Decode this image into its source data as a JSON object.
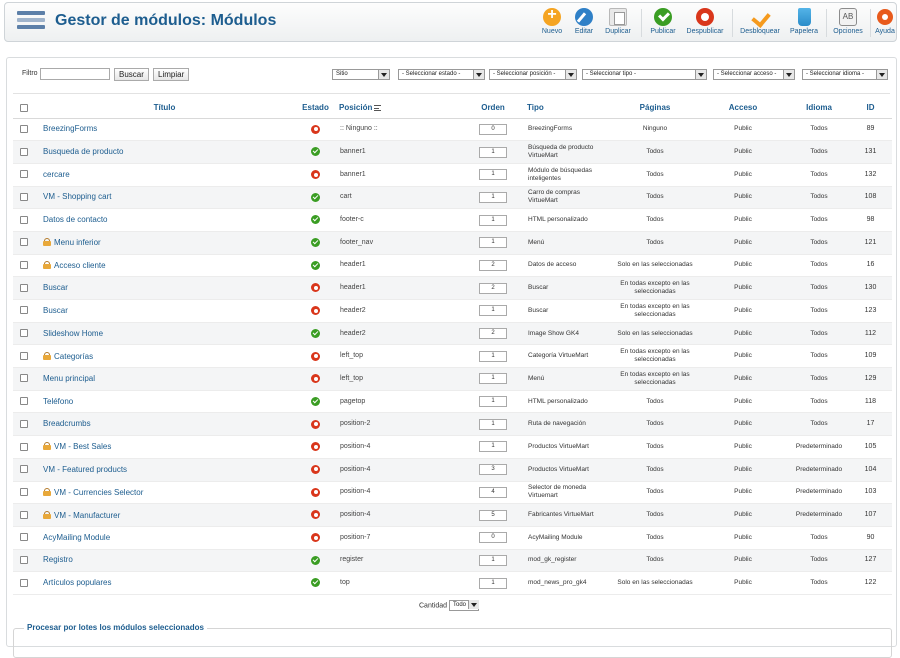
{
  "header": {
    "title": "Gestor de módulos: Módulos",
    "buttons": [
      {
        "id": "new",
        "label": "Nuevo",
        "icon": "plus-circle-icon"
      },
      {
        "id": "edit",
        "label": "Editar",
        "icon": "pencil-icon"
      },
      {
        "id": "copy",
        "label": "Duplicar",
        "icon": "copy-icon"
      },
      {
        "id": "publish",
        "label": "Publicar",
        "icon": "check-circle-icon"
      },
      {
        "id": "unpublish",
        "label": "Despublicar",
        "icon": "stop-circle-icon"
      },
      {
        "id": "unlock",
        "label": "Desbloquear",
        "icon": "checkin-icon"
      },
      {
        "id": "trash",
        "label": "Papelera",
        "icon": "trash-icon"
      },
      {
        "id": "options",
        "label": "Opciones",
        "icon": "options-icon"
      },
      {
        "id": "help",
        "label": "Ayuda",
        "icon": "help-lifebuoy-icon"
      }
    ]
  },
  "filters": {
    "search_label": "Filtro",
    "search_value": "",
    "search_button": "Buscar",
    "clear_button": "Limpiar",
    "client": "Sitio",
    "state": "- Seleccionar estado -",
    "position": "- Seleccionar posición -",
    "type": "- Seleccionar tipo -",
    "access": "- Seleccionar acceso -",
    "language": "- Seleccionar idioma -"
  },
  "table": {
    "columns": {
      "title": "Título",
      "state": "Estado",
      "position": "Posición",
      "order": "Orden",
      "type": "Tipo",
      "pages": "Páginas",
      "access": "Acceso",
      "language": "Idioma",
      "id": "ID"
    },
    "rows": [
      {
        "title": "BreezingForms",
        "locked": false,
        "published": false,
        "position": ":: Ninguno ::",
        "order": "0",
        "type": "BreezingForms",
        "pages": "Ninguno",
        "access": "Public",
        "language": "Todos",
        "id": "89"
      },
      {
        "title": "Busqueda de producto",
        "locked": false,
        "published": true,
        "position": "banner1",
        "order": "1",
        "type": "Búsqueda de producto VirtueMart",
        "pages": "Todos",
        "access": "Public",
        "language": "Todos",
        "id": "131"
      },
      {
        "title": "cercare",
        "locked": false,
        "published": false,
        "position": "banner1",
        "order": "1",
        "type": "Módulo de búsquedas inteligentes",
        "pages": "Todos",
        "access": "Public",
        "language": "Todos",
        "id": "132"
      },
      {
        "title": "VM - Shopping cart",
        "locked": false,
        "published": true,
        "position": "cart",
        "order": "1",
        "type": "Carro de compras VirtueMart",
        "pages": "Todos",
        "access": "Public",
        "language": "Todos",
        "id": "108"
      },
      {
        "title": "Datos de contacto",
        "locked": false,
        "published": true,
        "position": "footer-c",
        "order": "1",
        "type": "HTML personalizado",
        "pages": "Todos",
        "access": "Public",
        "language": "Todos",
        "id": "98"
      },
      {
        "title": "Menu inferior",
        "locked": true,
        "published": true,
        "position": "footer_nav",
        "order": "1",
        "type": "Menú",
        "pages": "Todos",
        "access": "Public",
        "language": "Todos",
        "id": "121"
      },
      {
        "title": "Acceso cliente",
        "locked": true,
        "published": true,
        "position": "header1",
        "order": "2",
        "type": "Datos de acceso",
        "pages": "Solo en las seleccionadas",
        "access": "Public",
        "language": "Todos",
        "id": "16"
      },
      {
        "title": "Buscar",
        "locked": false,
        "published": false,
        "position": "header1",
        "order": "2",
        "type": "Buscar",
        "pages": "En todas excepto en las seleccionadas",
        "access": "Public",
        "language": "Todos",
        "id": "130"
      },
      {
        "title": "Buscar",
        "locked": false,
        "published": false,
        "position": "header2",
        "order": "1",
        "type": "Buscar",
        "pages": "En todas excepto en las seleccionadas",
        "access": "Public",
        "language": "Todos",
        "id": "123"
      },
      {
        "title": "Slideshow Home",
        "locked": false,
        "published": true,
        "position": "header2",
        "order": "2",
        "type": "Image Show GK4",
        "pages": "Solo en las seleccionadas",
        "access": "Public",
        "language": "Todos",
        "id": "112"
      },
      {
        "title": "Categorías",
        "locked": true,
        "published": false,
        "position": "left_top",
        "order": "1",
        "type": "Categoría VirtueMart",
        "pages": "En todas excepto en las seleccionadas",
        "access": "Public",
        "language": "Todos",
        "id": "109"
      },
      {
        "title": "Menu principal",
        "locked": false,
        "published": false,
        "position": "left_top",
        "order": "1",
        "type": "Menú",
        "pages": "En todas excepto en las seleccionadas",
        "access": "Public",
        "language": "Todos",
        "id": "129"
      },
      {
        "title": "Teléfono",
        "locked": false,
        "published": true,
        "position": "pagetop",
        "order": "1",
        "type": "HTML personalizado",
        "pages": "Todos",
        "access": "Public",
        "language": "Todos",
        "id": "118"
      },
      {
        "title": "Breadcrumbs",
        "locked": false,
        "published": false,
        "position": "position-2",
        "order": "1",
        "type": "Ruta de navegación",
        "pages": "Todos",
        "access": "Public",
        "language": "Todos",
        "id": "17"
      },
      {
        "title": "VM - Best Sales",
        "locked": true,
        "published": false,
        "position": "position-4",
        "order": "1",
        "type": "Productos VirtueMart",
        "pages": "Todos",
        "access": "Public",
        "language": "Predeterminado",
        "id": "105"
      },
      {
        "title": "VM - Featured products",
        "locked": false,
        "published": false,
        "position": "position-4",
        "order": "3",
        "type": "Productos VirtueMart",
        "pages": "Todos",
        "access": "Public",
        "language": "Predeterminado",
        "id": "104"
      },
      {
        "title": "VM - Currencies Selector",
        "locked": true,
        "published": false,
        "position": "position-4",
        "order": "4",
        "type": "Selector de moneda Virtuemart",
        "pages": "Todos",
        "access": "Public",
        "language": "Predeterminado",
        "id": "103"
      },
      {
        "title": "VM - Manufacturer",
        "locked": true,
        "published": false,
        "position": "position-4",
        "order": "5",
        "type": "Fabricantes VirtueMart",
        "pages": "Todos",
        "access": "Public",
        "language": "Predeterminado",
        "id": "107"
      },
      {
        "title": "AcyMailing Module",
        "locked": false,
        "published": false,
        "position": "position-7",
        "order": "0",
        "type": "AcyMailing Module",
        "pages": "Todos",
        "access": "Public",
        "language": "Todos",
        "id": "90"
      },
      {
        "title": "Registro",
        "locked": false,
        "published": true,
        "position": "register",
        "order": "1",
        "type": "mod_gk_register",
        "pages": "Todos",
        "access": "Public",
        "language": "Todos",
        "id": "127"
      },
      {
        "title": "Artículos populares",
        "locked": false,
        "published": true,
        "position": "top",
        "order": "1",
        "type": "mod_news_pro_gk4",
        "pages": "Solo en las seleccionadas",
        "access": "Public",
        "language": "Todos",
        "id": "122"
      }
    ]
  },
  "footer": {
    "count_label": "Cantidad",
    "count_value": "Todo"
  },
  "batch": {
    "title": "Procesar por lotes los módulos seleccionados"
  }
}
